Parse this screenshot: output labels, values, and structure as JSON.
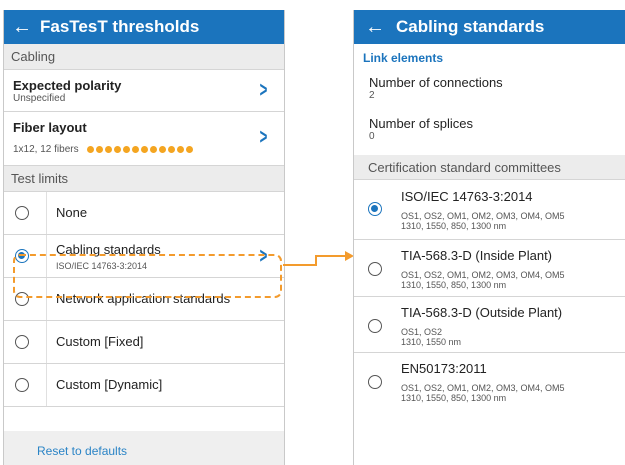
{
  "left": {
    "title": "FasTesT thresholds",
    "back_icon": "←",
    "cabling_section": "Cabling",
    "expected_polarity": {
      "label": "Expected polarity",
      "value": "Unspecified"
    },
    "fiber_layout": {
      "label": "Fiber layout",
      "value": "1x12, 12 fibers",
      "fiber_dot_count": 12
    },
    "test_limits_section": "Test limits",
    "options": [
      {
        "label": "None",
        "sub": "",
        "selected": false
      },
      {
        "label": "Cabling standards",
        "sub": "ISO/IEC 14763-3:2014",
        "selected": true
      },
      {
        "label": "Network application standards",
        "sub": "",
        "selected": false
      },
      {
        "label": "Custom [Fixed]",
        "sub": "",
        "selected": false
      },
      {
        "label": "Custom [Dynamic]",
        "sub": "",
        "selected": false
      }
    ],
    "reset": "Reset to defaults"
  },
  "right": {
    "title": "Cabling standards",
    "back_icon": "←",
    "link_elements": "Link elements",
    "connections": {
      "label": "Number of connections",
      "value": "2"
    },
    "splices": {
      "label": "Number of splices",
      "value": "0"
    },
    "committees_section": "Certification standard committees",
    "standards": [
      {
        "name": "ISO/IEC 14763-3:2014",
        "types": "OS1, OS2, OM1, OM2, OM3, OM4, OM5",
        "wavelengths": "1310, 1550, 850, 1300 nm",
        "selected": true
      },
      {
        "name": "TIA-568.3-D (Inside Plant)",
        "types": "OS1, OS2, OM1, OM2, OM3, OM4, OM5",
        "wavelengths": "1310, 1550, 850, 1300 nm",
        "selected": false
      },
      {
        "name": "TIA-568.3-D (Outside Plant)",
        "types": "OS1, OS2",
        "wavelengths": "1310, 1550 nm",
        "selected": false
      },
      {
        "name": "EN50173:2011",
        "types": "OS1, OS2, OM1, OM2, OM3, OM4, OM5",
        "wavelengths": "1310, 1550, 850, 1300 nm",
        "selected": false
      }
    ]
  },
  "icons": {
    "chevron": "chevron-right-icon",
    "back": "arrow-left-icon",
    "radio": "radio-button-icon"
  },
  "colors": {
    "primary": "#1b74bd",
    "accent_orange": "#f39b2d",
    "fiber_dot": "#f4a521"
  }
}
